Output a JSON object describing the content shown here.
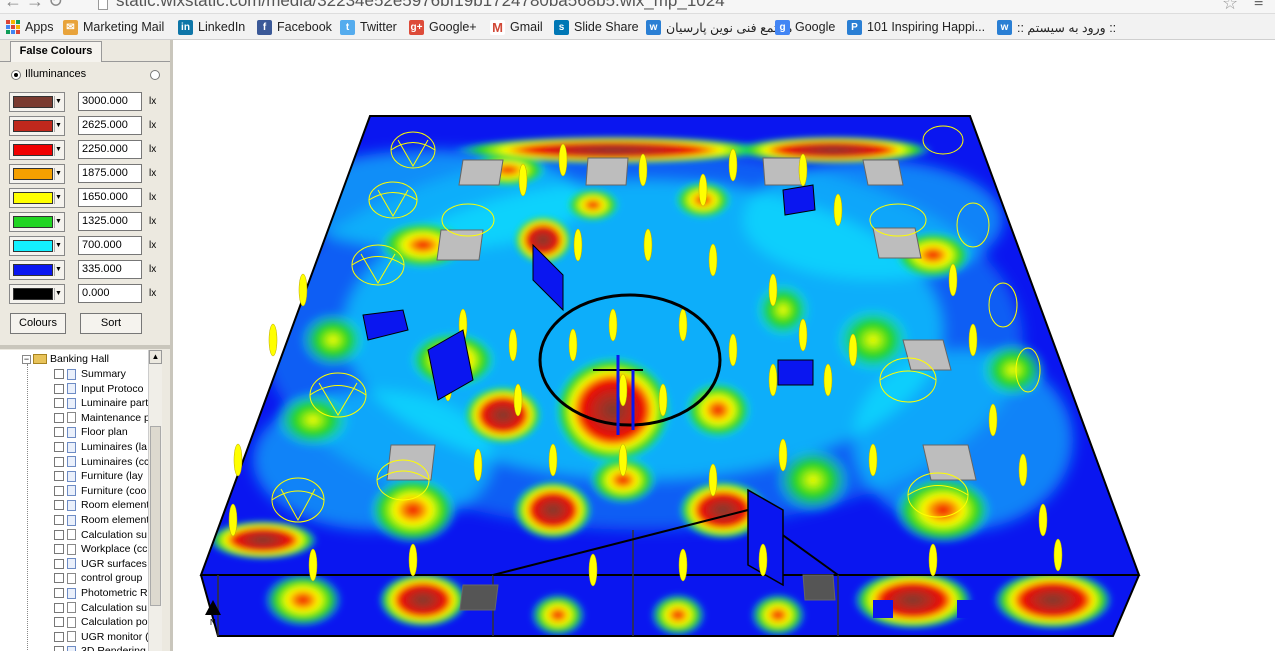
{
  "browser": {
    "url": "static.wixstatic.com/media/32234e52e5976bf19b1724780ba568b5.wix_mp_1024",
    "bookmarks": [
      {
        "label": "Apps",
        "icon": "apps-grid-icon"
      },
      {
        "label": "Marketing Mail",
        "icon": "mail-icon",
        "color": "#e8a33b"
      },
      {
        "label": "LinkedIn",
        "icon": "linkedin-icon",
        "color": "#0e76a8"
      },
      {
        "label": "Facebook",
        "icon": "facebook-icon",
        "color": "#3b5998"
      },
      {
        "label": "Twitter",
        "icon": "twitter-icon",
        "color": "#55acee"
      },
      {
        "label": "Google+",
        "icon": "google-plus-icon",
        "color": "#dd4b39"
      },
      {
        "label": "Gmail",
        "icon": "gmail-icon",
        "color": "#d14836"
      },
      {
        "label": "Slide Share",
        "icon": "slideshare-icon",
        "color": "#0077b5"
      },
      {
        "label": "مجتمع فنی نوین پارسیان",
        "icon": "site-icon",
        "color": "#2a7fd4"
      },
      {
        "label": "Google",
        "icon": "google-icon",
        "color": "#4285f4"
      },
      {
        "label": "101 Inspiring Happi...",
        "icon": "p-icon",
        "color": "#2a7fd4"
      },
      {
        "label": ":: ورود به سیستم ::",
        "icon": "site-icon",
        "color": "#2a7fd4"
      }
    ]
  },
  "panel": {
    "tab_label": "False Colours",
    "radio_label": "Illuminances",
    "unit": "lx",
    "levels": [
      {
        "color": "#7a3b30",
        "value": "3000.000"
      },
      {
        "color": "#c0281c",
        "value": "2625.000"
      },
      {
        "color": "#f00000",
        "value": "2250.000"
      },
      {
        "color": "#f5a000",
        "value": "1875.000"
      },
      {
        "color": "#ffff00",
        "value": "1650.000"
      },
      {
        "color": "#22d422",
        "value": "1325.000"
      },
      {
        "color": "#14f0ff",
        "value": "700.000"
      },
      {
        "color": "#0a16f0",
        "value": "335.000"
      },
      {
        "color": "#000000",
        "value": "0.000"
      }
    ],
    "colours_button": "Colours",
    "sort_button": "Sort"
  },
  "tree": {
    "root": "Banking Hall",
    "items": [
      {
        "label": "Summary",
        "doc": true
      },
      {
        "label": "Input Protoco",
        "doc": true
      },
      {
        "label": "Luminaire part",
        "doc": true
      },
      {
        "label": "Maintenance p",
        "doc": false
      },
      {
        "label": "Floor plan",
        "doc": true
      },
      {
        "label": "Luminaires (la",
        "doc": true
      },
      {
        "label": "Luminaires (cc",
        "doc": true
      },
      {
        "label": "Furniture (lay",
        "doc": true
      },
      {
        "label": "Furniture (coo",
        "doc": true
      },
      {
        "label": "Room element",
        "doc": true
      },
      {
        "label": "Room element",
        "doc": true
      },
      {
        "label": "Calculation su",
        "doc": false
      },
      {
        "label": "Workplace (cc",
        "doc": false
      },
      {
        "label": "UGR surfaces",
        "doc": true
      },
      {
        "label": "control group",
        "doc": false
      },
      {
        "label": "Photometric R",
        "doc": true
      },
      {
        "label": "Calculation su",
        "doc": false
      },
      {
        "label": "Calculation po",
        "doc": false
      },
      {
        "label": "UGR monitor (",
        "doc": false
      },
      {
        "label": "3D Rendering",
        "doc": true
      }
    ]
  }
}
